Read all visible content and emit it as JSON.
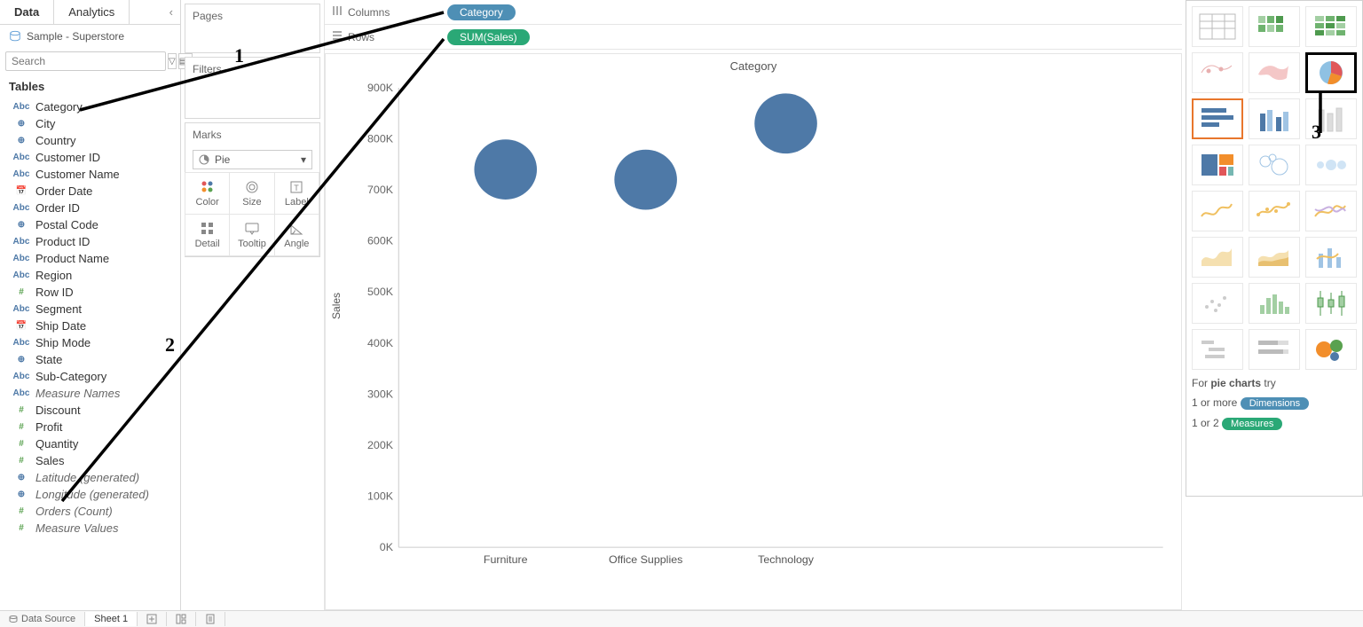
{
  "leftTabs": {
    "data": "Data",
    "analytics": "Analytics"
  },
  "dataSource": "Sample - Superstore",
  "search": {
    "placeholder": "Search"
  },
  "tablesHeader": "Tables",
  "fields": [
    {
      "icon": "abc",
      "label": "Category"
    },
    {
      "icon": "geo",
      "label": "City"
    },
    {
      "icon": "geo",
      "label": "Country"
    },
    {
      "icon": "abc",
      "label": "Customer ID"
    },
    {
      "icon": "abc",
      "label": "Customer Name"
    },
    {
      "icon": "date",
      "label": "Order Date"
    },
    {
      "icon": "abc",
      "label": "Order ID"
    },
    {
      "icon": "geo",
      "label": "Postal Code"
    },
    {
      "icon": "abc",
      "label": "Product ID"
    },
    {
      "icon": "abc",
      "label": "Product Name"
    },
    {
      "icon": "abc",
      "label": "Region"
    },
    {
      "icon": "num",
      "label": "Row ID"
    },
    {
      "icon": "abc",
      "label": "Segment"
    },
    {
      "icon": "date",
      "label": "Ship Date"
    },
    {
      "icon": "abc",
      "label": "Ship Mode"
    },
    {
      "icon": "geo",
      "label": "State"
    },
    {
      "icon": "abc",
      "label": "Sub-Category"
    },
    {
      "icon": "abc",
      "label": "Measure Names",
      "italic": true
    },
    {
      "icon": "num",
      "label": "Discount"
    },
    {
      "icon": "num",
      "label": "Profit"
    },
    {
      "icon": "num",
      "label": "Quantity"
    },
    {
      "icon": "num",
      "label": "Sales"
    },
    {
      "icon": "geo",
      "label": "Latitude (generated)",
      "italic": true
    },
    {
      "icon": "geo",
      "label": "Longitude (generated)",
      "italic": true
    },
    {
      "icon": "num",
      "label": "Orders (Count)",
      "italic": true
    },
    {
      "icon": "num",
      "label": "Measure Values",
      "italic": true
    }
  ],
  "cards": {
    "pages": "Pages",
    "filters": "Filters",
    "marks": "Marks",
    "markType": "Pie"
  },
  "markCells": [
    "Color",
    "Size",
    "Label",
    "Detail",
    "Tooltip",
    "Angle"
  ],
  "shelves": {
    "columnsLabel": "Columns",
    "rowsLabel": "Rows",
    "colPill": "Category",
    "rowPill": "SUM(Sales)"
  },
  "chart_data": {
    "type": "scatter",
    "title": "Category",
    "xlabel": "",
    "ylabel": "Sales",
    "categories": [
      "Furniture",
      "Office Supplies",
      "Technology"
    ],
    "values": [
      740000,
      720000,
      830000
    ],
    "ylim": [
      0,
      900000
    ],
    "yticks": [
      "0K",
      "100K",
      "200K",
      "300K",
      "400K",
      "500K",
      "600K",
      "700K",
      "800K",
      "900K"
    ]
  },
  "showMe": {
    "hintPrefix": "For ",
    "hintBold": "pie charts",
    "hintSuffix": " try",
    "line1a": "1 or more ",
    "line1pill": "Dimensions",
    "line2a": "1 or 2 ",
    "line2pill": "Measures"
  },
  "bottomTabs": {
    "dataSource": "Data Source",
    "sheet1": "Sheet 1"
  },
  "annotations": {
    "a1": "1",
    "a2": "2",
    "a3": "3"
  }
}
